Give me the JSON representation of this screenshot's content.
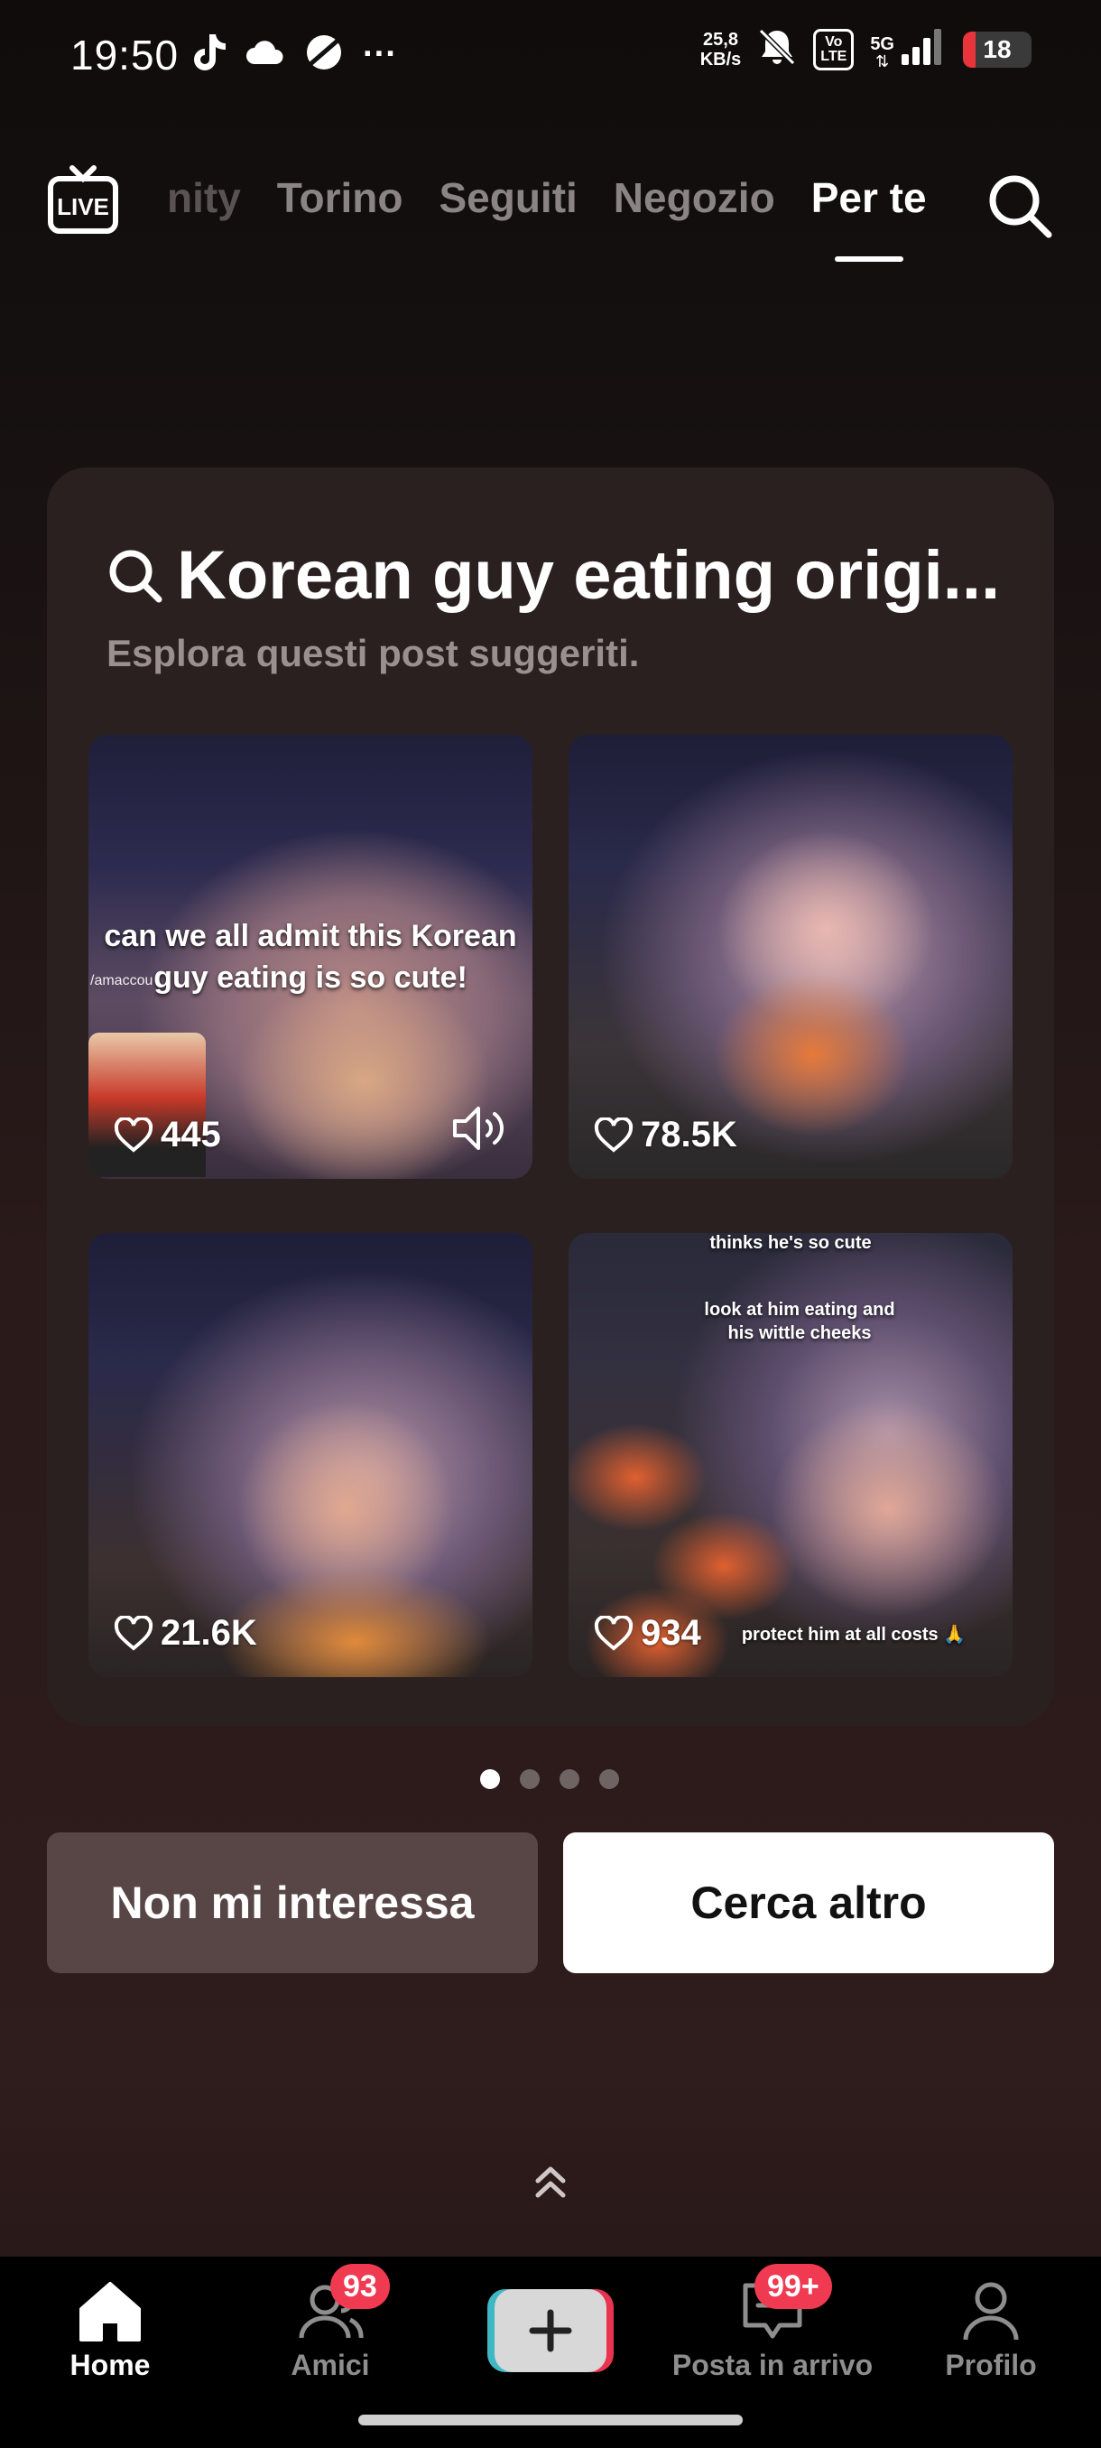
{
  "status_bar": {
    "time": "19:50",
    "net_speed_value": "25,8",
    "net_speed_unit": "KB/s",
    "volte_top": "Vo",
    "volte_bottom": "LTE",
    "network": "5G",
    "battery": "18",
    "battery_level": 0.18,
    "battery_color": "#e8343a",
    "overflow": "···"
  },
  "top_nav": {
    "live_label": "LIVE",
    "tabs": [
      {
        "label": "nity",
        "state": "partial"
      },
      {
        "label": "Torino",
        "state": "inactive"
      },
      {
        "label": "Seguiti",
        "state": "inactive"
      },
      {
        "label": "Negozio",
        "state": "inactive"
      },
      {
        "label": "Per te",
        "state": "active"
      }
    ]
  },
  "suggestion_card": {
    "title": "Korean guy eating origi...",
    "subtitle": "Esplora questi post suggeriti.",
    "posts": [
      {
        "likes": "445",
        "caption": "can we all admit this Korean guy eating is so cute!",
        "overlay_text": "/amaccou",
        "sound": true
      },
      {
        "likes": "78.5K"
      },
      {
        "likes": "21.6K"
      },
      {
        "likes": "934",
        "caption_top": "thinks he's so cute",
        "caption_mid": "look at him eating and his wittle cheeks",
        "caption_bottom": "protect him at all costs 🙏"
      }
    ]
  },
  "pager": {
    "pages": 4,
    "current": 1
  },
  "actions": {
    "not_interested": "Non mi interessa",
    "search_more": "Cerca altro"
  },
  "bottom_nav": {
    "home": "Home",
    "friends": "Amici",
    "friends_badge": "93",
    "inbox": "Posta in arrivo",
    "inbox_badge": "99+",
    "profile": "Profilo"
  },
  "colors": {
    "accent_badge": "#f03a52",
    "card_bg": "#2a2020",
    "secondary_button": "#584646"
  }
}
